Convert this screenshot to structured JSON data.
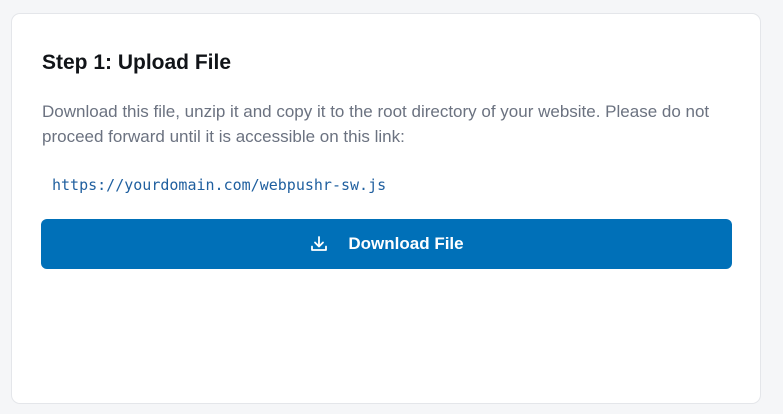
{
  "card": {
    "title": "Step 1: Upload File",
    "description": "Download this file, unzip it and copy it to the root directory of your website. Please do not proceed forward until it is accessible on this link:",
    "link": "https://yourdomain.com/webpushr-sw.js",
    "download_button": {
      "label": "Download File",
      "icon": "download-icon"
    }
  },
  "colors": {
    "accent": "#0070b8",
    "link": "#1f5f9f",
    "text_muted": "#6b7280",
    "title": "#111418"
  }
}
